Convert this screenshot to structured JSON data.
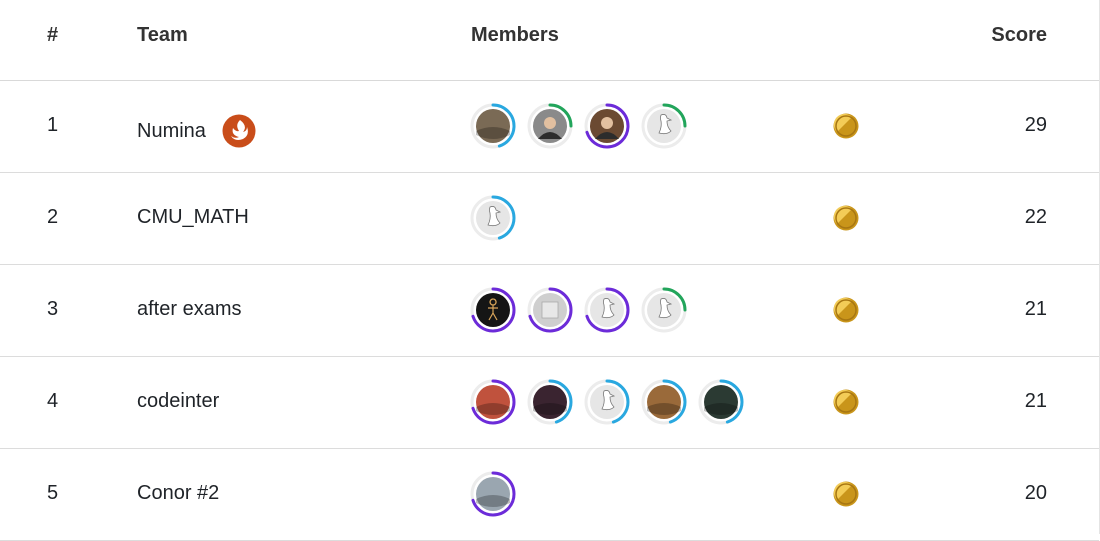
{
  "header": {
    "rank_label": "#",
    "team_label": "Team",
    "members_label": "Members",
    "score_label": "Score"
  },
  "colors": {
    "ring_blue": "#29a8e0",
    "ring_green": "#22a55b",
    "ring_purple": "#6c2bd9",
    "medal_gold": "#c9951a",
    "logo_orange": "#c94d1a"
  },
  "rows": [
    {
      "rank": "1",
      "team": "Numina",
      "team_logo": "flame-logo-icon",
      "members": [
        {
          "icon": "city-photo-avatar",
          "ring": "blue",
          "progress": 0.45,
          "bg": "#7a6a55"
        },
        {
          "icon": "person-photo-avatar",
          "ring": "green",
          "progress": 0.25,
          "bg": "#8a8a8a"
        },
        {
          "icon": "person-photo-avatar",
          "ring": "purple",
          "progress": 0.7,
          "bg": "#6b4a32"
        },
        {
          "icon": "goose-avatar",
          "ring": "green",
          "progress": 0.25,
          "bg": "#e6e6e6"
        }
      ],
      "medal": "gold-medal-icon",
      "score": "29"
    },
    {
      "rank": "2",
      "team": "CMU_MATH",
      "team_logo": "",
      "members": [
        {
          "icon": "goose-avatar",
          "ring": "blue",
          "progress": 0.45,
          "bg": "#e6e6e6"
        }
      ],
      "medal": "gold-medal-icon",
      "score": "22"
    },
    {
      "rank": "3",
      "team": "after exams",
      "team_logo": "",
      "members": [
        {
          "icon": "stick-figure-avatar",
          "ring": "purple",
          "progress": 0.7,
          "bg": "#151515"
        },
        {
          "icon": "pattern-avatar",
          "ring": "purple",
          "progress": 0.7,
          "bg": "#cfcfcf"
        },
        {
          "icon": "goose-avatar",
          "ring": "purple",
          "progress": 0.7,
          "bg": "#e6e6e6"
        },
        {
          "icon": "goose-avatar",
          "ring": "green",
          "progress": 0.25,
          "bg": "#e6e6e6"
        }
      ],
      "medal": "gold-medal-icon",
      "score": "21"
    },
    {
      "rank": "4",
      "team": "codeinter",
      "team_logo": "",
      "members": [
        {
          "icon": "flowers-photo-avatar",
          "ring": "purple",
          "progress": 0.7,
          "bg": "#c0523d"
        },
        {
          "icon": "anime-avatar",
          "ring": "blue",
          "progress": 0.45,
          "bg": "#3a2430"
        },
        {
          "icon": "goose-avatar",
          "ring": "blue",
          "progress": 0.45,
          "bg": "#e6e6e6"
        },
        {
          "icon": "dog-photo-avatar",
          "ring": "blue",
          "progress": 0.45,
          "bg": "#9a6a3a"
        },
        {
          "icon": "dark-photo-avatar",
          "ring": "blue",
          "progress": 0.45,
          "bg": "#2b3a33"
        }
      ],
      "medal": "gold-medal-icon",
      "score": "21"
    },
    {
      "rank": "5",
      "team": "Conor #2",
      "team_logo": "",
      "members": [
        {
          "icon": "landscape-photo-avatar",
          "ring": "purple",
          "progress": 0.7,
          "bg": "#9aa6b0"
        }
      ],
      "medal": "gold-medal-icon",
      "score": "20"
    }
  ]
}
